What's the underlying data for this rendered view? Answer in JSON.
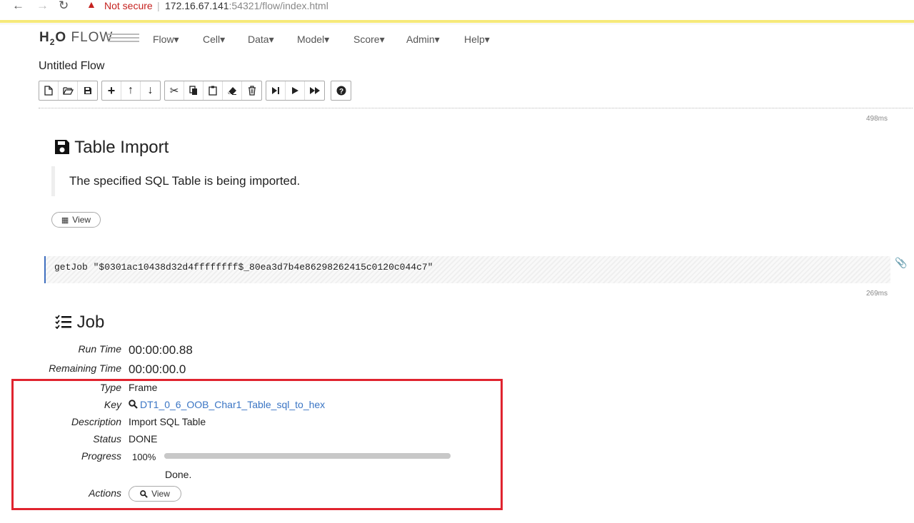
{
  "browser": {
    "not_secure": "Not secure",
    "host": "172.16.67.141",
    "path": ":54321/flow/index.html"
  },
  "header": {
    "logo": {
      "h": "H",
      "sub": "2",
      "o": "O",
      "flow": "FLOW"
    },
    "menu": [
      "Flow▾",
      "Cell▾",
      "Data▾",
      "Model▾",
      "Score▾",
      "Admin▾",
      "Help▾"
    ],
    "title": "Untitled Flow"
  },
  "toolbar": {
    "icons": [
      "new-file-icon",
      "open-folder-icon",
      "save-icon",
      "insert-cell-icon",
      "move-up-icon",
      "move-down-icon",
      "cut-icon",
      "copy-icon",
      "paste-icon",
      "clear-icon",
      "delete-icon",
      "run-step-icon",
      "run-icon",
      "run-all-icon",
      "help-icon"
    ]
  },
  "cells": {
    "import": {
      "time": "498ms",
      "heading": "Table Import",
      "message": "The specified SQL Table is being imported.",
      "view_label": "View"
    },
    "getjob": {
      "code": "getJob \"$0301ac10438d32d4ffffffff$_80ea3d7b4e86298262415c0120c044c7\"",
      "time": "269ms"
    },
    "job": {
      "heading": "Job",
      "run_time_label": "Run Time",
      "run_time": "00:00:00.88",
      "remaining_time_label": "Remaining Time",
      "remaining_time": "00:00:00.0",
      "type_label": "Type",
      "type": "Frame",
      "key_label": "Key",
      "key": "DT1_0_6_OOB_Char1_Table_sql_to_hex",
      "description_label": "Description",
      "description": "Import SQL Table",
      "status_label": "Status",
      "status": "DONE",
      "progress_label": "Progress",
      "progress_text": "100%",
      "progress_value": 1.0,
      "done": "Done.",
      "actions_label": "Actions",
      "view_label": "View"
    }
  },
  "colors": {
    "highlight": "#e0242f",
    "link": "#3a75c4",
    "accent_bar": "#f6e97a"
  }
}
